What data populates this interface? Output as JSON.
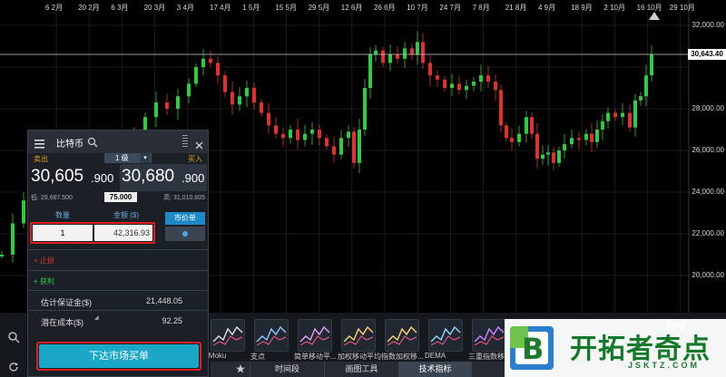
{
  "chart": {
    "dates": [
      "6 2月",
      "20 2月",
      "6 3月",
      "20 3月",
      "3 4月",
      "17 4月",
      "1 5月",
      "15 5月",
      "29 5月",
      "12 6月",
      "26 6月",
      "10 7月",
      "24 7月",
      "7 8月",
      "21 8月",
      "4 9月",
      "18 9月",
      "2 10月",
      "16 10月",
      "29 10月"
    ],
    "price_levels": [
      "32,000.00",
      "30,000.00",
      "28,000.00",
      "26,000.00",
      "24,000.00",
      "22,000.00",
      "20,000.00"
    ],
    "current_price": "30,643.40",
    "up_color": "#2ecc40",
    "down_color": "#e03030"
  },
  "panel": {
    "menu_icon": "menu-icon",
    "title": "比特币",
    "search_icon": "search-icon",
    "close_icon": "close-icon",
    "sell_label": "卖出",
    "level_label": "1 级",
    "buy_label": "买入",
    "sell_price_main": "30,605",
    "sell_price_suffix": ".900",
    "buy_price_main": "30,680",
    "buy_price_suffix": ".900",
    "low_label": "低: 29,687.500",
    "spread": "75.000",
    "high_label": "高: 31,010.805",
    "quantity_header": "数量",
    "amount_header": "金额 ($)",
    "market_order_tab": "市价单",
    "quantity_value": "1",
    "amount_value": "42,316.93",
    "stop_loss": "+ 止损",
    "take_profit": "+ 获利",
    "margin_label": "估计保证金($)",
    "margin_value": "21,448.05",
    "potential_cost_label": "潜在成本($)",
    "potential_cost_value": "92.25",
    "submit_label": "下达市场买单"
  },
  "indicators": [
    {
      "label": "iMoku"
    },
    {
      "label": "支点"
    },
    {
      "label": "简单移动平..."
    },
    {
      "label": "加权移动平均"
    },
    {
      "label": "指数加权移..."
    },
    {
      "label": "DEMA"
    },
    {
      "label": "三重指数移..."
    }
  ],
  "tabs": [
    "",
    "时间段",
    "画图工具",
    "技术指标",
    ""
  ],
  "watermark": {
    "logo_letter": "B",
    "name": "开拓者奇点",
    "url": "JSKTZ.COM"
  }
}
